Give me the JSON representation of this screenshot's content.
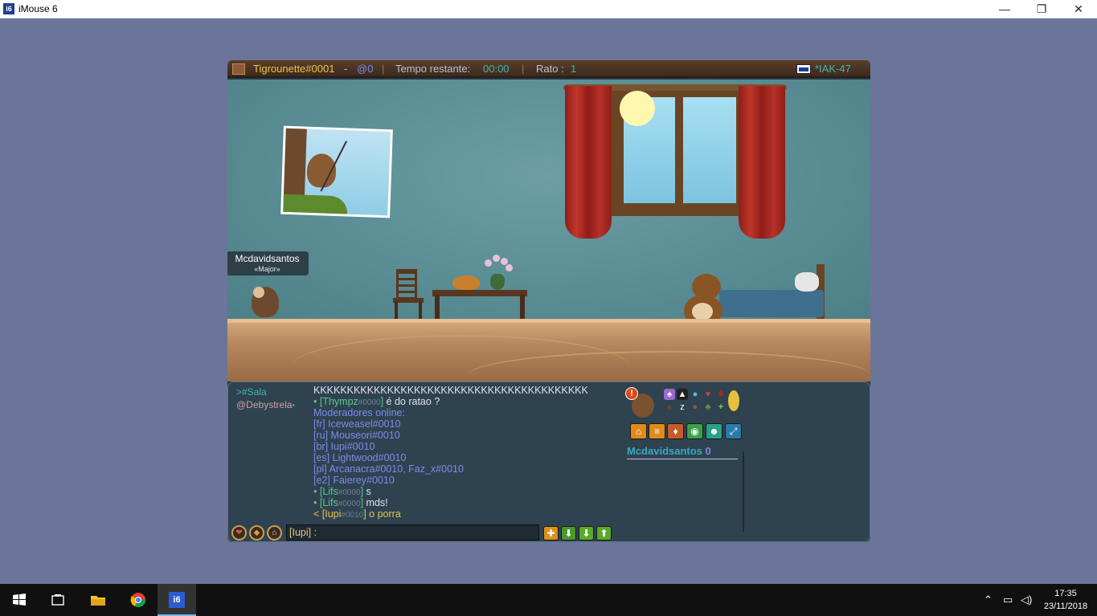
{
  "window": {
    "title": "iMouse 6",
    "app_icon": "i6",
    "minimize": "—",
    "restore": "❐",
    "close": "✕"
  },
  "hud": {
    "player": "Tigrounette#0001",
    "dash": " - ",
    "mention": "@0",
    "sep": "|",
    "time_label": "Tempo restante:",
    "time_value": "00:00",
    "rato_label": "Rato :",
    "rato_value": "1",
    "map_code": "*IAK-47"
  },
  "scene": {
    "nametag_name": "Mcdavidsantos",
    "nametag_title": "«Major»"
  },
  "chat": {
    "channels": [
      {
        "label": ">#Sala",
        "color": "#3fb8b0"
      },
      {
        "label": "@Debystrela",
        "color": "#d0a0a8"
      }
    ],
    "channel_suffix": "•",
    "lines": [
      {
        "parts": [
          {
            "t": "KKKKKKKKKKKKKKKKKKKKKKKKKKKKKKKKKKKKKKKKK",
            "c": "c-white"
          }
        ]
      },
      {
        "parts": [
          {
            "t": "• [Thympz",
            "c": "c-green"
          },
          {
            "t": "#0000",
            "c": "c-dim"
          },
          {
            "t": "] ",
            "c": "c-green"
          },
          {
            "t": "é do ratao ?",
            "c": "c-white"
          }
        ]
      },
      {
        "parts": [
          {
            "t": "Moderadores online:",
            "c": "c-blue"
          }
        ]
      },
      {
        "parts": [
          {
            "t": "[fr] ",
            "c": "c-blue"
          },
          {
            "t": "Iceweasel#0010",
            "c": "c-blue"
          }
        ]
      },
      {
        "parts": [
          {
            "t": "[ru] ",
            "c": "c-blue"
          },
          {
            "t": "Mouseori#0010",
            "c": "c-blue"
          }
        ]
      },
      {
        "parts": [
          {
            "t": "[br] ",
            "c": "c-blue"
          },
          {
            "t": "Iupi#0010",
            "c": "c-blue"
          }
        ]
      },
      {
        "parts": [
          {
            "t": "[es] ",
            "c": "c-blue"
          },
          {
            "t": "Lightwood#0010",
            "c": "c-blue"
          }
        ]
      },
      {
        "parts": [
          {
            "t": "[pl] ",
            "c": "c-blue"
          },
          {
            "t": "Arcanacra#0010, Faz_x#0010",
            "c": "c-blue"
          }
        ]
      },
      {
        "parts": [
          {
            "t": "[e2] ",
            "c": "c-blue"
          },
          {
            "t": "Faierey#0010",
            "c": "c-blue"
          }
        ]
      },
      {
        "parts": [
          {
            "t": "• [Lifs",
            "c": "c-green"
          },
          {
            "t": "#0000",
            "c": "c-dim"
          },
          {
            "t": "] ",
            "c": "c-green"
          },
          {
            "t": "s",
            "c": "c-white"
          }
        ]
      },
      {
        "parts": [
          {
            "t": "• [Lifs",
            "c": "c-green"
          },
          {
            "t": "#0000",
            "c": "c-dim"
          },
          {
            "t": "] ",
            "c": "c-green"
          },
          {
            "t": "mds!",
            "c": "c-white"
          }
        ]
      },
      {
        "parts": [
          {
            "t": "< [Iupi",
            "c": "c-yellow"
          },
          {
            "t": "#0010",
            "c": "c-dim"
          },
          {
            "t": "] ",
            "c": "c-yellow"
          },
          {
            "t": "o porra",
            "c": "c-yellow"
          }
        ]
      }
    ],
    "input_value": "[Iupi] :",
    "input_buttons": [
      {
        "icon": "plus-icon",
        "glyph": "✚",
        "color": "#e0901a"
      },
      {
        "icon": "arrow-down-icon",
        "glyph": "⬇",
        "color": "#4a9a2a"
      },
      {
        "icon": "arrow-down-icon",
        "glyph": "⬇",
        "color": "#5aaa2a"
      },
      {
        "icon": "arrow-up-icon",
        "glyph": "⬆",
        "color": "#5aaa2a"
      }
    ]
  },
  "ranking": {
    "player": "Mcdavidsantos",
    "score": "0"
  },
  "taskbar": {
    "time": "17:35",
    "date": "23/11/2018"
  }
}
